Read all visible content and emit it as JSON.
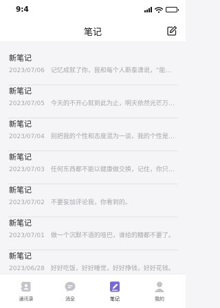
{
  "status_bar": {
    "time": "9:4"
  },
  "header": {
    "title": "笔记",
    "compose_icon": "edit-icon"
  },
  "notes": [
    {
      "title": "新笔记",
      "date": "2023/07/06",
      "preview": "记忆成就了你，我和每个人斯泰潇说，“能够…"
    },
    {
      "title": "新笔记",
      "date": "2023/07/05",
      "preview": "今天的不开心就到此为止，明天依然光芒万丈…"
    },
    {
      "title": "新笔记",
      "date": "2023/07/04",
      "preview": "别把我的个性和态度混为一谈，我的个性是源…"
    },
    {
      "title": "新笔记",
      "date": "2023/07/03",
      "preview": "任何东西都不能以健康做交换，记住，你只能…"
    },
    {
      "title": "新笔记",
      "date": "2023/07/02",
      "preview": "不要妄加评论我，你看到的。"
    },
    {
      "title": "新笔记",
      "date": "2023/07/01",
      "preview": "做一个沉默不语的哑巴，谁给的糖都不要了。"
    },
    {
      "title": "新笔记",
      "date": "2023/06/28",
      "preview": "好好吃饭，好好睡觉，好好挣钱，好好花钱。"
    }
  ],
  "tab_bar": {
    "active_color": "#7a68cf",
    "tabs": [
      {
        "label": "通讯录",
        "icon": "contacts-icon",
        "active": false
      },
      {
        "label": "消息",
        "icon": "message-icon",
        "active": false
      },
      {
        "label": "笔记",
        "icon": "notes-icon",
        "active": true
      },
      {
        "label": "我的",
        "icon": "profile-icon",
        "active": false
      }
    ]
  }
}
